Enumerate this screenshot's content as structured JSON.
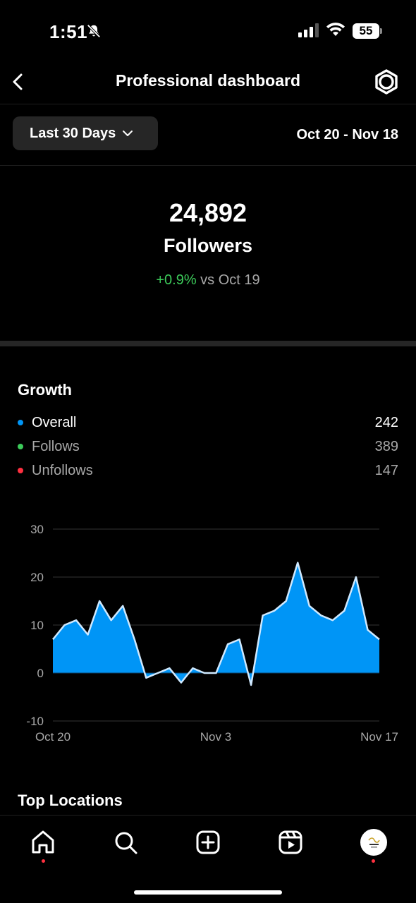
{
  "status_bar": {
    "time": "1:51",
    "battery": "55"
  },
  "nav": {
    "title": "Professional dashboard"
  },
  "filter": {
    "range_label": "Last 30 Days",
    "date_range": "Oct 20 - Nov 18"
  },
  "summary": {
    "count": "24,892",
    "label": "Followers",
    "delta": "+0.9%",
    "delta_suffix": " vs Oct 19"
  },
  "growth": {
    "title": "Growth",
    "legend": [
      {
        "label": "Overall",
        "value": "242",
        "color": "#0095f6"
      },
      {
        "label": "Follows",
        "value": "389",
        "color": "#3ccb5a"
      },
      {
        "label": "Unfollows",
        "value": "147",
        "color": "#ff3040"
      }
    ]
  },
  "chart_data": {
    "type": "area",
    "series": [
      {
        "name": "Overall",
        "color": "#0095f6",
        "values": [
          7,
          10,
          11,
          8,
          15,
          11,
          14,
          7,
          -1,
          0,
          1,
          -2,
          1,
          0,
          0,
          6,
          7,
          -2.5,
          12,
          13,
          15,
          23,
          14,
          12,
          11,
          13,
          20,
          9,
          7
        ]
      }
    ],
    "x_labels": [
      "Oct 20",
      "Nov 3",
      "Nov 17"
    ],
    "y_ticks": [
      30,
      20,
      10,
      0,
      -10
    ],
    "ylim": [
      -10,
      30
    ],
    "grid": true
  },
  "sections": {
    "next_title": "Top Locations"
  },
  "tabs": {
    "home": "home-icon",
    "search": "search-icon",
    "create": "create-icon",
    "reels": "reels-icon",
    "profile": "profile-avatar"
  }
}
